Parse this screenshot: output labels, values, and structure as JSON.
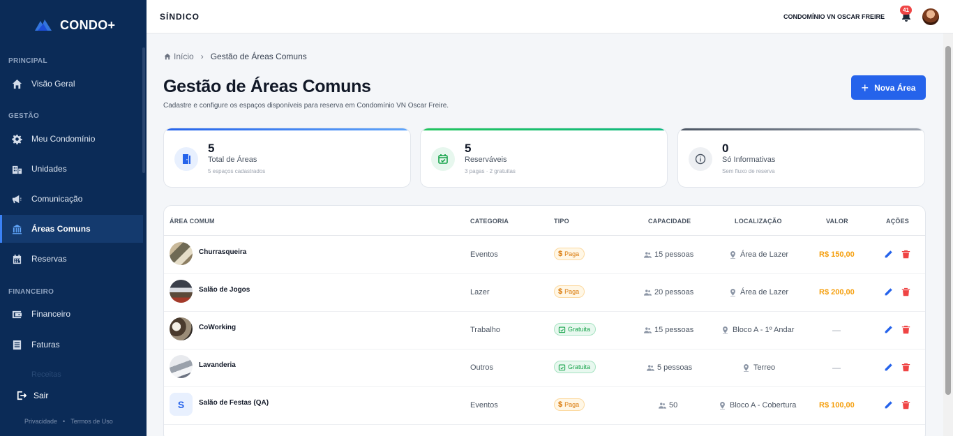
{
  "brand": {
    "name": "CONDO+"
  },
  "sidebar": {
    "sections": [
      "PRINCIPAL",
      "GESTÃO",
      "FINANCEIRO"
    ],
    "items": [
      {
        "label": "Visão Geral",
        "icon": "home-icon"
      },
      {
        "label": "Meu Condomínio",
        "icon": "gear-icon"
      },
      {
        "label": "Unidades",
        "icon": "building-icon"
      },
      {
        "label": "Comunicação",
        "icon": "megaphone-icon"
      },
      {
        "label": "Áreas Comuns",
        "icon": "areas-icon"
      },
      {
        "label": "Reservas",
        "icon": "calendar-icon"
      },
      {
        "label": "Financeiro",
        "icon": "wallet-icon"
      },
      {
        "label": "Faturas",
        "icon": "invoice-icon"
      }
    ],
    "faded_item": "Receitas",
    "logout": "Sair",
    "footer": [
      "Privacidade",
      "Termos de Uso"
    ]
  },
  "header": {
    "role": "SÍNDICO",
    "condo": "CONDOMÍNIO VN OSCAR FREIRE",
    "notifications": "41"
  },
  "breadcrumb": {
    "home": "Início",
    "current": "Gestão de Áreas Comuns"
  },
  "page": {
    "title": "Gestão de Áreas Comuns",
    "subtitle": "Cadastre e configure os espaços disponíveis para reserva em Condomínio VN Oscar Freire.",
    "new_button": "Nova Área"
  },
  "stats": [
    {
      "value": "5",
      "label": "Total de Áreas",
      "note": "5 espaços cadastrados",
      "color": "#3b82f6"
    },
    {
      "value": "5",
      "label": "Reserváveis",
      "note": "3 pagas · 2 gratuitas",
      "color": "#22c55e"
    },
    {
      "value": "0",
      "label": "Só Informativas",
      "note": "Sem fluxo de reserva",
      "color": "#6b7280"
    }
  ],
  "table": {
    "headers": [
      "ÁREA COMUM",
      "CATEGORIA",
      "TIPO",
      "CAPACIDADE",
      "LOCALIZAÇÃO",
      "VALOR",
      "AÇÕES"
    ],
    "rows": [
      {
        "name": "Churrasqueira",
        "category": "Eventos",
        "type": "Paga",
        "capacity": "15 pessoas",
        "location": "Área de Lazer",
        "value": "R$ 150,00"
      },
      {
        "name": "Salão de Jogos",
        "category": "Lazer",
        "type": "Paga",
        "capacity": "20 pessoas",
        "location": "Área de Lazer",
        "value": "R$ 200,00"
      },
      {
        "name": "CoWorking",
        "category": "Trabalho",
        "type": "Gratuita",
        "capacity": "15 pessoas",
        "location": "Bloco A - 1º Andar",
        "value": "—"
      },
      {
        "name": "Lavanderia",
        "category": "Outros",
        "type": "Gratuita",
        "capacity": "5 pessoas",
        "location": "Terreo",
        "value": "—"
      },
      {
        "name": "Salão de Festas (QA)",
        "category": "Eventos",
        "type": "Paga",
        "capacity": "50",
        "location": "Bloco A - Cobertura",
        "value": "R$ 100,00",
        "initial": "S"
      }
    ]
  }
}
